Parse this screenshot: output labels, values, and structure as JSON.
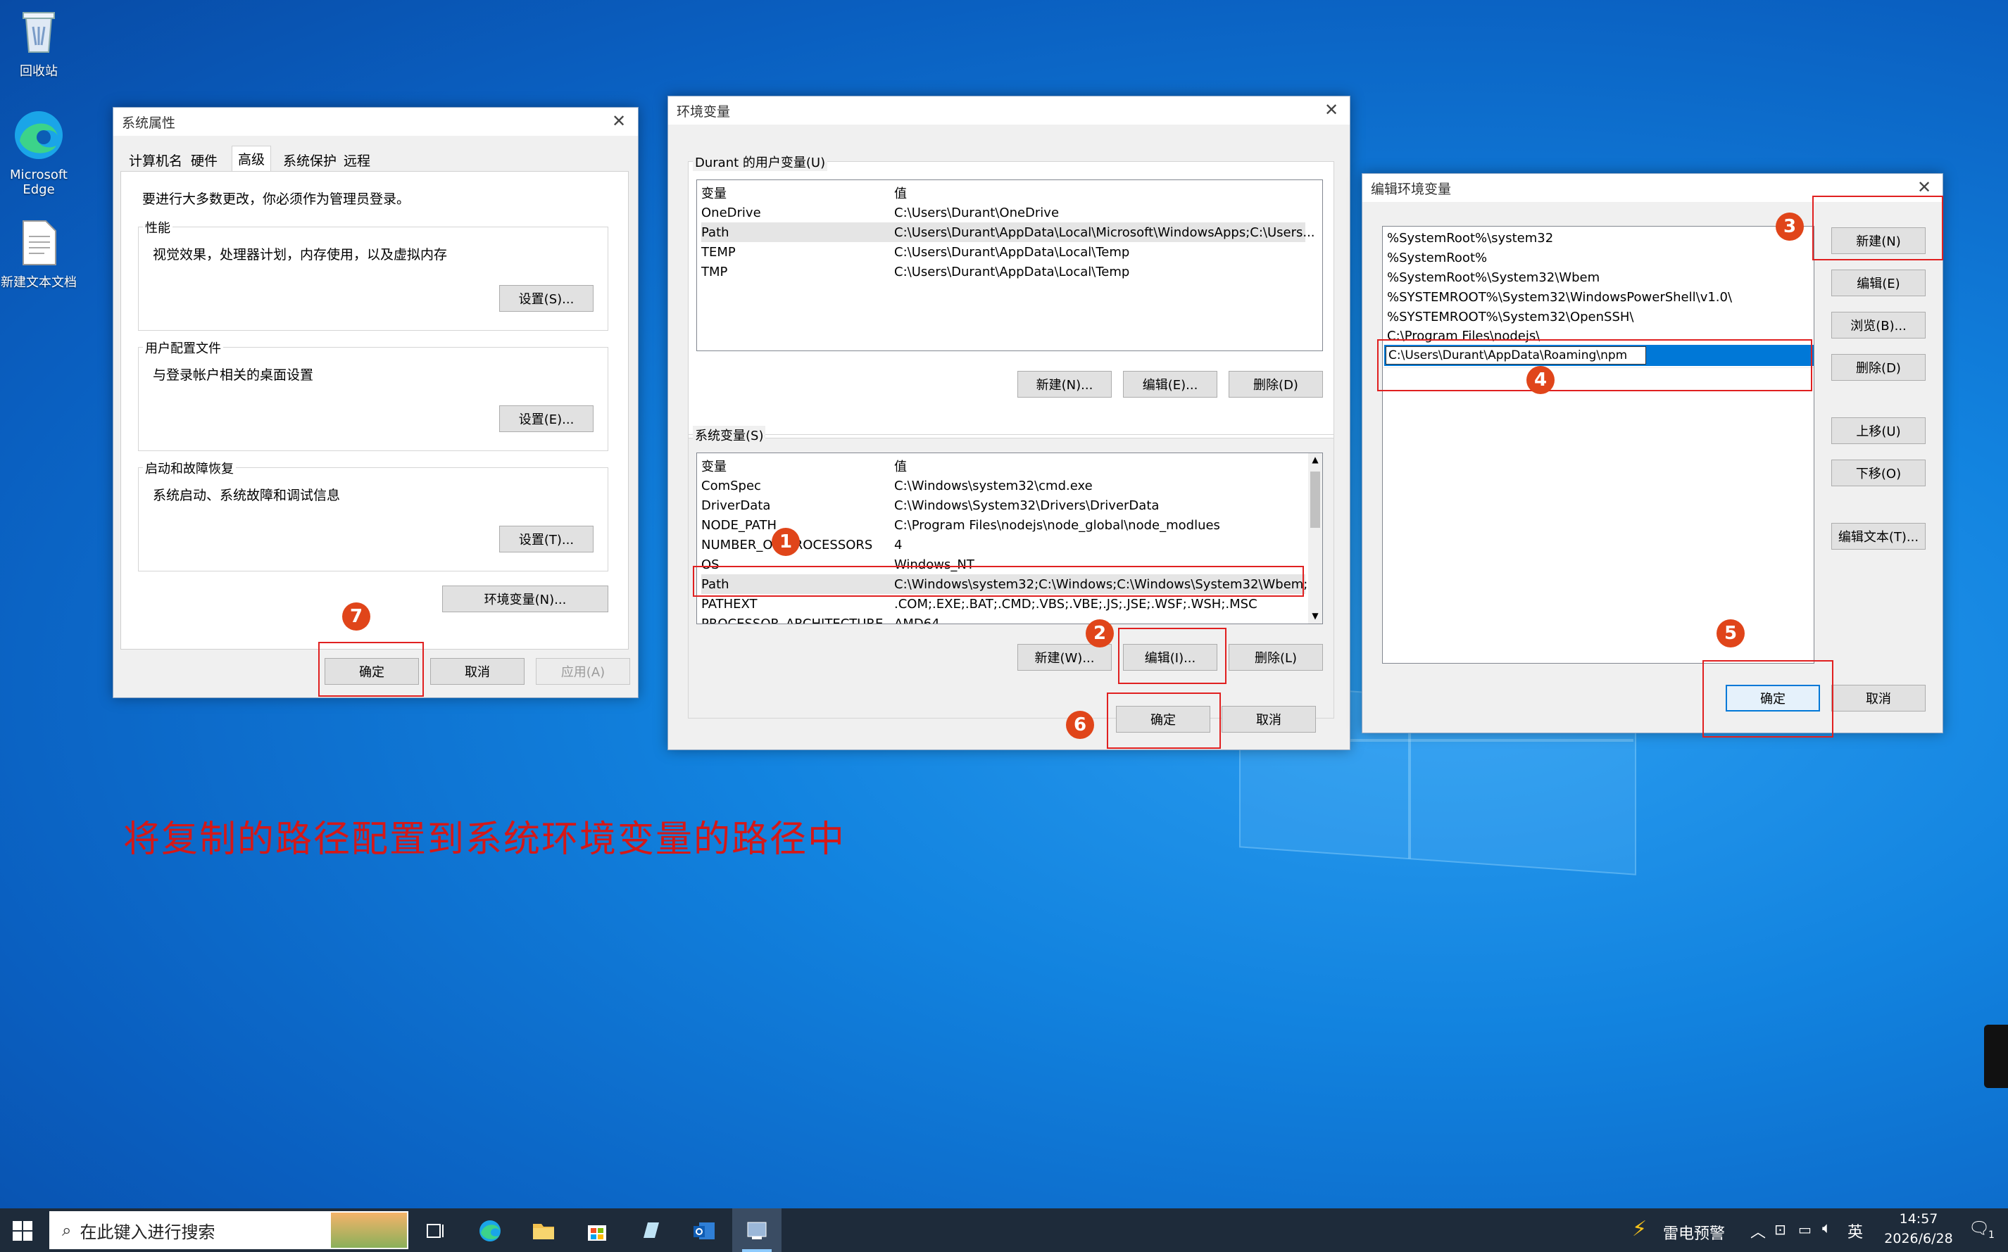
{
  "desktop": {
    "icons": [
      {
        "label": "回收站"
      },
      {
        "label": "Microsoft Edge"
      },
      {
        "label": "新建文本文档"
      }
    ],
    "caption": "将复制的路径配置到系统环境变量的路径中"
  },
  "sysprops": {
    "title": "系统属性",
    "tabs": [
      "计算机名",
      "硬件",
      "高级",
      "系统保护",
      "远程"
    ],
    "admin_note": "要进行大多数更改，你必须作为管理员登录。",
    "perf": {
      "label": "性能",
      "desc": "视觉效果，处理器计划，内存使用，以及虚拟内存",
      "button": "设置(S)..."
    },
    "profile": {
      "label": "用户配置文件",
      "desc": "与登录帐户相关的桌面设置",
      "button": "设置(E)..."
    },
    "startup": {
      "label": "启动和故障恢复",
      "desc": "系统启动、系统故障和调试信息",
      "button": "设置(T)..."
    },
    "env_button": "环境变量(N)...",
    "ok": "确定",
    "cancel": "取消",
    "apply": "应用(A)"
  },
  "envvars": {
    "title": "环境变量",
    "user_group": "Durant 的用户变量(U)",
    "col_var": "变量",
    "col_val": "值",
    "user_rows": [
      {
        "name": "OneDrive",
        "value": "C:\\Users\\Durant\\OneDrive"
      },
      {
        "name": "Path",
        "value": "C:\\Users\\Durant\\AppData\\Local\\Microsoft\\WindowsApps;C:\\Users..."
      },
      {
        "name": "TEMP",
        "value": "C:\\Users\\Durant\\AppData\\Local\\Temp"
      },
      {
        "name": "TMP",
        "value": "C:\\Users\\Durant\\AppData\\Local\\Temp"
      }
    ],
    "user_buttons": {
      "new": "新建(N)...",
      "edit": "编辑(E)...",
      "delete": "删除(D)"
    },
    "sys_group": "系统变量(S)",
    "sys_rows": [
      {
        "name": "ComSpec",
        "value": "C:\\Windows\\system32\\cmd.exe"
      },
      {
        "name": "DriverData",
        "value": "C:\\Windows\\System32\\Drivers\\DriverData"
      },
      {
        "name": "NODE_PATH",
        "value": "C:\\Program Files\\nodejs\\node_global\\node_modlues"
      },
      {
        "name": "NUMBER_OF_PROCESSORS",
        "value": "4"
      },
      {
        "name": "OS",
        "value": "Windows_NT"
      },
      {
        "name": "Path",
        "value": "C:\\Windows\\system32;C:\\Windows;C:\\Windows\\System32\\Wbem;..."
      },
      {
        "name": "PATHEXT",
        "value": ".COM;.EXE;.BAT;.CMD;.VBS;.VBE;.JS;.JSE;.WSF;.WSH;.MSC"
      },
      {
        "name": "PROCESSOR_ARCHITECTURE",
        "value": "AMD64"
      }
    ],
    "sys_buttons": {
      "new": "新建(W)...",
      "edit": "编辑(I)...",
      "delete": "删除(L)"
    },
    "ok": "确定",
    "cancel": "取消"
  },
  "editenv": {
    "title": "编辑环境变量",
    "entries": [
      "%SystemRoot%\\system32",
      "%SystemRoot%",
      "%SystemRoot%\\System32\\Wbem",
      "%SYSTEMROOT%\\System32\\WindowsPowerShell\\v1.0\\",
      "%SYSTEMROOT%\\System32\\OpenSSH\\",
      "C:\\Program Files\\nodejs\\"
    ],
    "editing_value": "C:\\Users\\Durant\\AppData\\Roaming\\npm",
    "buttons": {
      "new": "新建(N)",
      "edit": "编辑(E)",
      "browse": "浏览(B)...",
      "delete": "删除(D)",
      "up": "上移(U)",
      "down": "下移(O)",
      "edit_text": "编辑文本(T)..."
    },
    "ok": "确定",
    "cancel": "取消"
  },
  "badges": [
    "1",
    "2",
    "3",
    "4",
    "5",
    "6",
    "7"
  ],
  "taskbar": {
    "search_placeholder": "在此键入进行搜索",
    "weather_alert": "雷电预警",
    "ime": "英",
    "time": "14:57",
    "date": "2026/6/28",
    "notif_count": "1"
  }
}
